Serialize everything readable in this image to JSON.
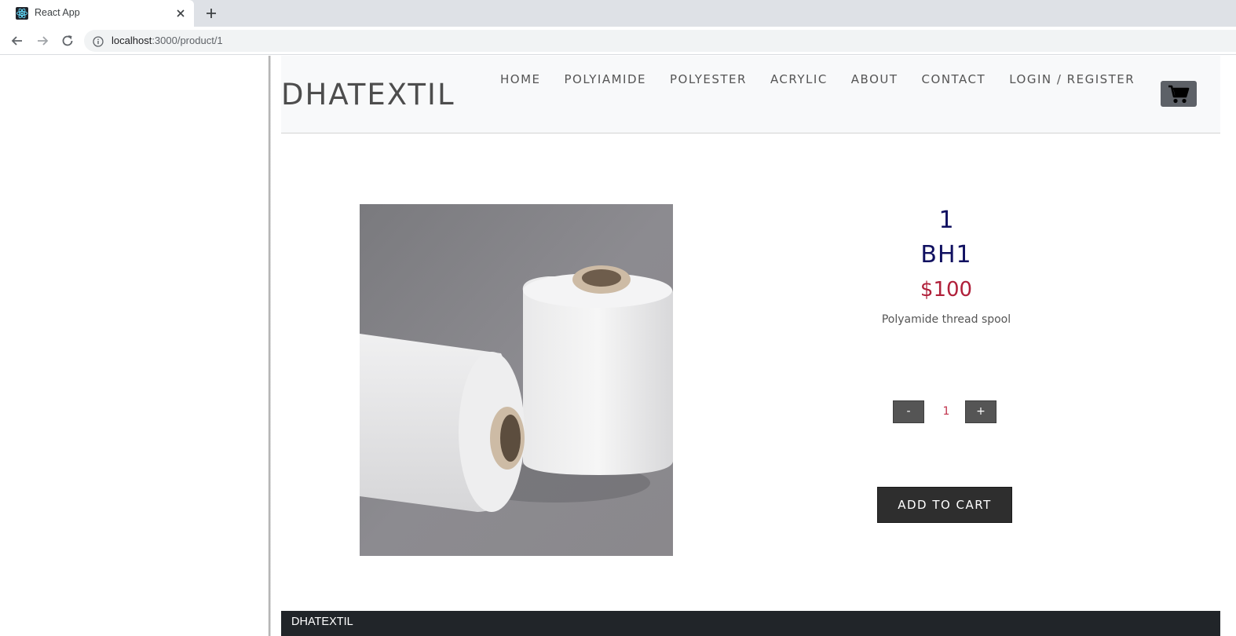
{
  "browser": {
    "tab_title": "React App",
    "url_host": "localhost",
    "url_path": ":3000/product/1",
    "icons": {
      "favicon": "react-logo-icon",
      "close": "close-icon",
      "new_tab": "plus-icon",
      "back": "arrow-left-icon",
      "forward": "arrow-right-icon",
      "reload": "reload-icon",
      "info": "info-icon"
    }
  },
  "navbar": {
    "brand": "DHATEXTIL",
    "links": [
      "HOME",
      "POLYIAMIDE",
      "POLYESTER",
      "ACRYLIC",
      "ABOUT",
      "CONTACT",
      "LOGIN / REGISTER"
    ],
    "cart_icon": "shopping-cart-icon"
  },
  "product": {
    "id": "1",
    "name": "BH1",
    "price": "$100",
    "description": "Polyamide thread spool",
    "quantity": "1",
    "minus_label": "-",
    "plus_label": "+",
    "add_to_cart_label": "ADD TO CART",
    "image_alt": "Polyamide thread spool"
  },
  "footer": {
    "brand": "DHATEXTIL"
  },
  "colors": {
    "title": "#101060",
    "price": "#b0203a",
    "footer_bg": "#212529",
    "navbar_bg": "#f8f9fa"
  }
}
